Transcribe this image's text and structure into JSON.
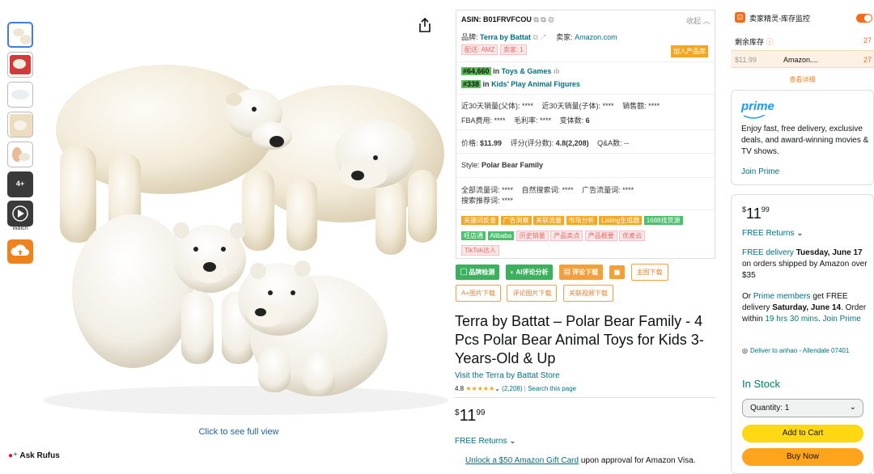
{
  "thumbs": {
    "more": "4+",
    "video_label": "Watch"
  },
  "main": {
    "click_full": "Click to see full view",
    "rufus": "Ask Rufus"
  },
  "seller": {
    "asin": "ASIN: B01FRVFCOU",
    "collapse": "收起",
    "brand_label": "品牌:",
    "brand": "Terra by Battat",
    "seller_label": "卖家:",
    "seller": "Amazon.com",
    "ship": "配送: AMZ",
    "seller_count": "卖家: 1",
    "add_lib": "加入产品库",
    "rank1": "#64,660",
    "rank1_in": "in",
    "rank1_cat": "Toys & Games",
    "rank2": "#338",
    "rank2_in": "in",
    "rank2_cat": "Kids' Play Animal Figures",
    "sales_parent": "近30天销量(父体): ****",
    "sales_child": "近30天销量(子体): ****",
    "revenue": "销售额: ****",
    "fba": "FBA费用: ****",
    "margin": "毛利率: ****",
    "variants_label": "变体数:",
    "variants": "6",
    "price_label": "价格:",
    "price": "$11.99",
    "rating_label": "评分(评分数):",
    "rating": "4.8(2,208)",
    "qa": "Q&A数: --",
    "style_label": "Style:",
    "style": "Polar Bear Family",
    "traffic": "全部流量词: ****",
    "organic": "自然搜索词: ****",
    "ad": "广告流量词: ****",
    "recommend": "搜索推荐词: ****",
    "tags_row1": [
      "关键词反查",
      "广告洞察",
      "关联流量",
      "市场分析",
      "Listing生成器",
      "1688找货源"
    ],
    "tags_row2": [
      "旺店通",
      "Alibaba",
      "历史销量",
      "产品卖点",
      "产品概要",
      "优麦云"
    ],
    "tags_row3": [
      "TikTok达人"
    ]
  },
  "buttons": {
    "brand_check": "品牌检测",
    "ai_review": "AI评论分析",
    "review_dl": "评论下载",
    "main_img_dl": "主图下载",
    "aplus_dl": "A+图片下载",
    "review_img_dl": "评论图片下载",
    "video_dl": "关联视频下载"
  },
  "product": {
    "title": "Terra by Battat – Polar Bear Family - 4 Pcs Polar Bear Animal Toys for Kids 3-Years-Old & Up",
    "store": "Visit the Terra by Battat Store",
    "rating": "4.8",
    "stars": "★★★★★",
    "rating_count": "(2,208)",
    "search_page": "Search this page",
    "price_sym": "$",
    "price_whole": "11",
    "price_frac": "99",
    "free_returns": "FREE Returns",
    "gift_link": "Unlock a $50 Amazon Gift Card",
    "gift_rest": "upon approval for Amazon Visa."
  },
  "monitor": {
    "title": "卖家精灵-库存监控",
    "stock_label": "剩余库存",
    "stock_value": "27",
    "row_price": "$11.99",
    "row_seller": "Amazon....",
    "row_stock": "27",
    "details": "查看详细"
  },
  "prime": {
    "logo": "prime",
    "text": "Enjoy fast, free delivery, exclusive deals, and award-winning movies & TV shows.",
    "join": "Join Prime"
  },
  "buybox": {
    "price_sym": "$",
    "price_whole": "11",
    "price_frac": "99",
    "free_returns": "FREE Returns",
    "delivery_link": "FREE delivery",
    "delivery_date": "Tuesday, June 17",
    "delivery_rest": "on orders shipped by Amazon over $35",
    "or": "Or",
    "prime_members": "Prime members",
    "get_free": "get FREE delivery",
    "fast_date": "Saturday, June 14",
    "order_within": "Order within",
    "countdown": "19 hrs 30 mins",
    "join": "Join Prime",
    "deliver_to": "Deliver to anhao - Allendale 07401",
    "in_stock": "In Stock",
    "quantity": "Quantity: 1",
    "add_cart": "Add to Cart",
    "buy_now": "Buy Now"
  },
  "colors": {
    "accent_orange": "#f06c1e",
    "link": "#007185",
    "cart_yellow": "#ffd814",
    "buy_orange": "#ffa41c",
    "in_stock_green": "#067d62"
  }
}
